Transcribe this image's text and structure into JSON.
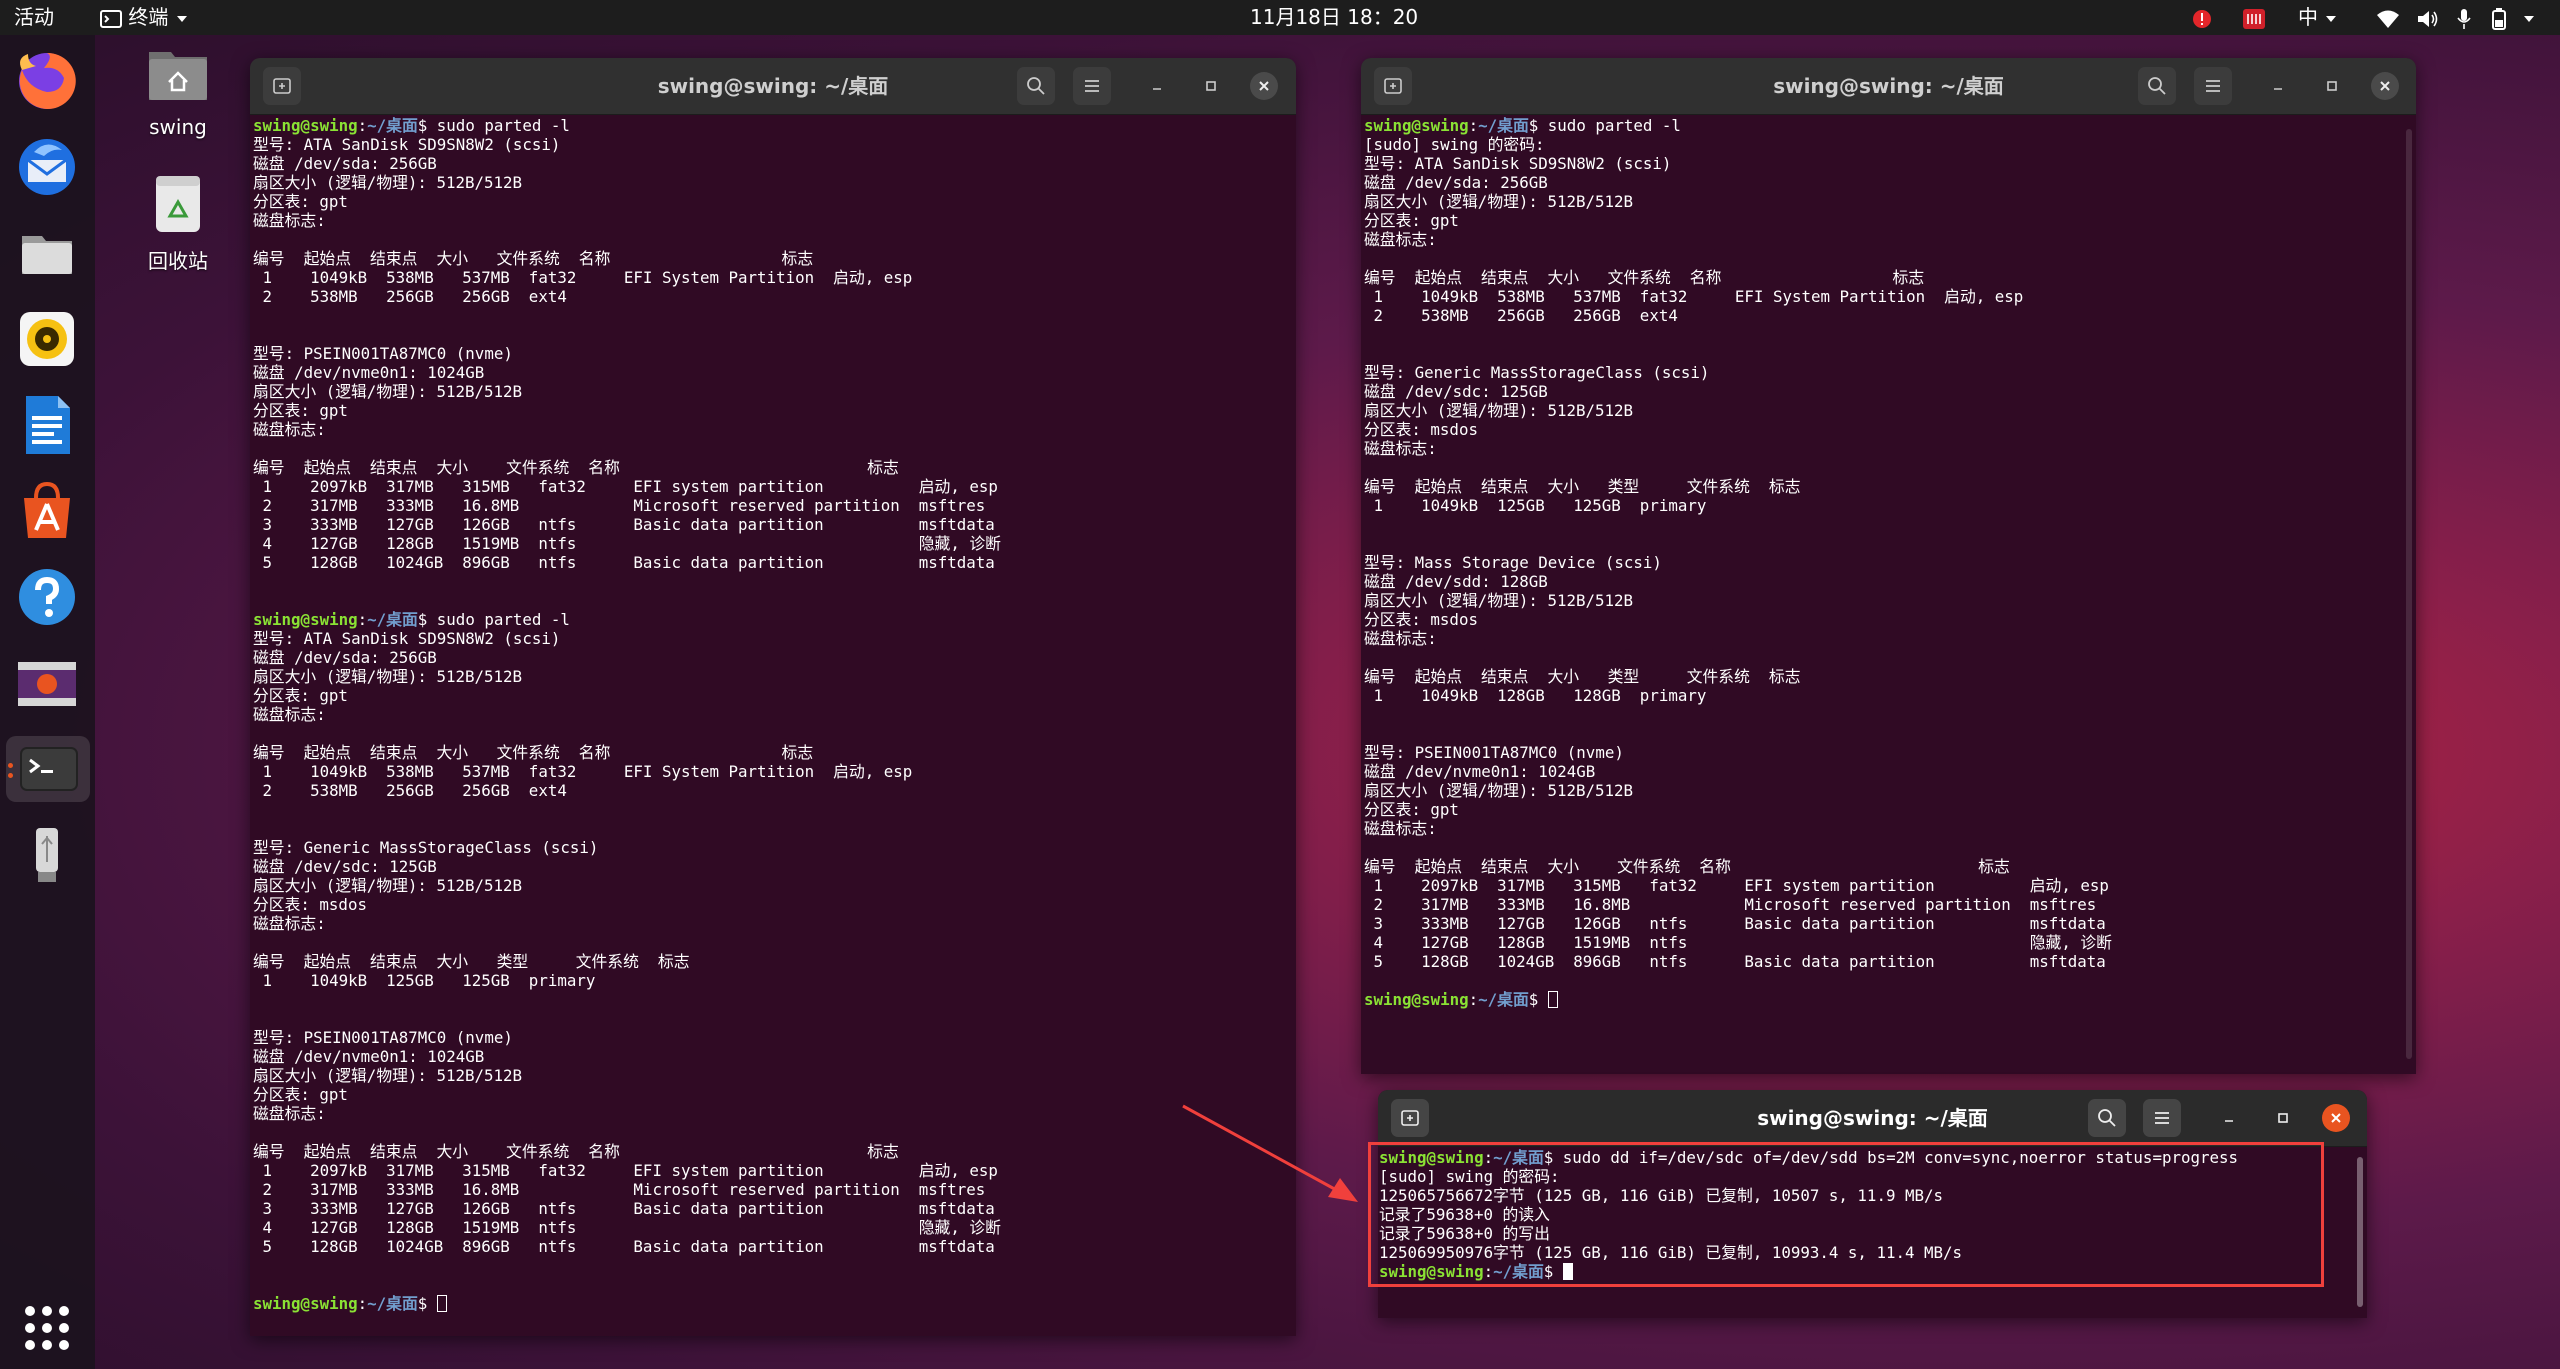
{
  "topbar": {
    "activities": "活动",
    "app_menu": "终端",
    "clock": "11月18日  18：20",
    "ime": "中",
    "accent_color": "#e95420"
  },
  "desktop": {
    "home_label": "swing",
    "trash_label": "回收站"
  },
  "dock": {
    "items": [
      "firefox-icon",
      "thunderbird-icon",
      "files-icon",
      "rhythmbox-icon",
      "writer-icon",
      "software-icon",
      "help-icon",
      "video-icon",
      "terminal-icon",
      "usb-drive-icon"
    ],
    "show_apps": "grid-icon"
  },
  "windows": {
    "left": {
      "title": "swing@swing: ~/桌面",
      "lines": [
        [
          {
            "t": "swing@swing",
            "c": "u"
          },
          {
            "t": ":"
          },
          {
            "t": "~/桌面",
            "c": "p"
          },
          {
            "t": "$ sudo parted -l"
          }
        ],
        [
          {
            "t": "型号: ATA SanDisk SD9SN8W2 (scsi)"
          }
        ],
        [
          {
            "t": "磁盘 /dev/sda: 256GB"
          }
        ],
        [
          {
            "t": "扇区大小 (逻辑/物理): 512B/512B"
          }
        ],
        [
          {
            "t": "分区表: gpt"
          }
        ],
        [
          {
            "t": "磁盘标志:"
          }
        ],
        [
          {
            "t": ""
          }
        ],
        [
          {
            "t": "编号  起始点  结束点  大小   文件系统  名称                  标志"
          }
        ],
        [
          {
            "t": " 1    1049kB  538MB   537MB  fat32     EFI System Partition  启动, esp"
          }
        ],
        [
          {
            "t": " 2    538MB   256GB   256GB  ext4"
          }
        ],
        [
          {
            "t": ""
          }
        ],
        [
          {
            "t": ""
          }
        ],
        [
          {
            "t": "型号: PSEIN001TA87MC0 (nvme)"
          }
        ],
        [
          {
            "t": "磁盘 /dev/nvme0n1: 1024GB"
          }
        ],
        [
          {
            "t": "扇区大小 (逻辑/物理): 512B/512B"
          }
        ],
        [
          {
            "t": "分区表: gpt"
          }
        ],
        [
          {
            "t": "磁盘标志:"
          }
        ],
        [
          {
            "t": ""
          }
        ],
        [
          {
            "t": "编号  起始点  结束点  大小    文件系统  名称                          标志"
          }
        ],
        [
          {
            "t": " 1    2097kB  317MB   315MB   fat32     EFI system partition          启动, esp"
          }
        ],
        [
          {
            "t": " 2    317MB   333MB   16.8MB            Microsoft reserved partition  msftres"
          }
        ],
        [
          {
            "t": " 3    333MB   127GB   126GB   ntfs      Basic data partition          msftdata"
          }
        ],
        [
          {
            "t": " 4    127GB   128GB   1519MB  ntfs                                    隐藏, 诊断"
          }
        ],
        [
          {
            "t": " 5    128GB   1024GB  896GB   ntfs      Basic data partition          msftdata"
          }
        ],
        [
          {
            "t": ""
          }
        ],
        [
          {
            "t": ""
          }
        ],
        [
          {
            "t": "swing@swing",
            "c": "u"
          },
          {
            "t": ":"
          },
          {
            "t": "~/桌面",
            "c": "p"
          },
          {
            "t": "$ sudo parted -l"
          }
        ],
        [
          {
            "t": "型号: ATA SanDisk SD9SN8W2 (scsi)"
          }
        ],
        [
          {
            "t": "磁盘 /dev/sda: 256GB"
          }
        ],
        [
          {
            "t": "扇区大小 (逻辑/物理): 512B/512B"
          }
        ],
        [
          {
            "t": "分区表: gpt"
          }
        ],
        [
          {
            "t": "磁盘标志:"
          }
        ],
        [
          {
            "t": ""
          }
        ],
        [
          {
            "t": "编号  起始点  结束点  大小   文件系统  名称                  标志"
          }
        ],
        [
          {
            "t": " 1    1049kB  538MB   537MB  fat32     EFI System Partition  启动, esp"
          }
        ],
        [
          {
            "t": " 2    538MB   256GB   256GB  ext4"
          }
        ],
        [
          {
            "t": ""
          }
        ],
        [
          {
            "t": ""
          }
        ],
        [
          {
            "t": "型号: Generic MassStorageClass (scsi)"
          }
        ],
        [
          {
            "t": "磁盘 /dev/sdc: 125GB"
          }
        ],
        [
          {
            "t": "扇区大小 (逻辑/物理): 512B/512B"
          }
        ],
        [
          {
            "t": "分区表: msdos"
          }
        ],
        [
          {
            "t": "磁盘标志:"
          }
        ],
        [
          {
            "t": ""
          }
        ],
        [
          {
            "t": "编号  起始点  结束点  大小   类型     文件系统  标志"
          }
        ],
        [
          {
            "t": " 1    1049kB  125GB   125GB  primary"
          }
        ],
        [
          {
            "t": ""
          }
        ],
        [
          {
            "t": ""
          }
        ],
        [
          {
            "t": "型号: PSEIN001TA87MC0 (nvme)"
          }
        ],
        [
          {
            "t": "磁盘 /dev/nvme0n1: 1024GB"
          }
        ],
        [
          {
            "t": "扇区大小 (逻辑/物理): 512B/512B"
          }
        ],
        [
          {
            "t": "分区表: gpt"
          }
        ],
        [
          {
            "t": "磁盘标志:"
          }
        ],
        [
          {
            "t": ""
          }
        ],
        [
          {
            "t": "编号  起始点  结束点  大小    文件系统  名称                          标志"
          }
        ],
        [
          {
            "t": " 1    2097kB  317MB   315MB   fat32     EFI system partition          启动, esp"
          }
        ],
        [
          {
            "t": " 2    317MB   333MB   16.8MB            Microsoft reserved partition  msftres"
          }
        ],
        [
          {
            "t": " 3    333MB   127GB   126GB   ntfs      Basic data partition          msftdata"
          }
        ],
        [
          {
            "t": " 4    127GB   128GB   1519MB  ntfs                                    隐藏, 诊断"
          }
        ],
        [
          {
            "t": " 5    128GB   1024GB  896GB   ntfs      Basic data partition          msftdata"
          }
        ],
        [
          {
            "t": ""
          }
        ],
        [
          {
            "t": ""
          }
        ],
        [
          {
            "t": "swing@swing",
            "c": "u"
          },
          {
            "t": ":"
          },
          {
            "t": "~/桌面",
            "c": "p"
          },
          {
            "t": "$ "
          },
          {
            "cursor": "hollow"
          }
        ]
      ]
    },
    "right": {
      "title": "swing@swing: ~/桌面",
      "lines": [
        [
          {
            "t": "swing@swing",
            "c": "u"
          },
          {
            "t": ":"
          },
          {
            "t": "~/桌面",
            "c": "p"
          },
          {
            "t": "$ sudo parted -l"
          }
        ],
        [
          {
            "t": "[sudo] swing 的密码:"
          }
        ],
        [
          {
            "t": "型号: ATA SanDisk SD9SN8W2 (scsi)"
          }
        ],
        [
          {
            "t": "磁盘 /dev/sda: 256GB"
          }
        ],
        [
          {
            "t": "扇区大小 (逻辑/物理): 512B/512B"
          }
        ],
        [
          {
            "t": "分区表: gpt"
          }
        ],
        [
          {
            "t": "磁盘标志:"
          }
        ],
        [
          {
            "t": ""
          }
        ],
        [
          {
            "t": "编号  起始点  结束点  大小   文件系统  名称                  标志"
          }
        ],
        [
          {
            "t": " 1    1049kB  538MB   537MB  fat32     EFI System Partition  启动, esp"
          }
        ],
        [
          {
            "t": " 2    538MB   256GB   256GB  ext4"
          }
        ],
        [
          {
            "t": ""
          }
        ],
        [
          {
            "t": ""
          }
        ],
        [
          {
            "t": "型号: Generic MassStorageClass (scsi)"
          }
        ],
        [
          {
            "t": "磁盘 /dev/sdc: 125GB"
          }
        ],
        [
          {
            "t": "扇区大小 (逻辑/物理): 512B/512B"
          }
        ],
        [
          {
            "t": "分区表: msdos"
          }
        ],
        [
          {
            "t": "磁盘标志:"
          }
        ],
        [
          {
            "t": ""
          }
        ],
        [
          {
            "t": "编号  起始点  结束点  大小   类型     文件系统  标志"
          }
        ],
        [
          {
            "t": " 1    1049kB  125GB   125GB  primary"
          }
        ],
        [
          {
            "t": ""
          }
        ],
        [
          {
            "t": ""
          }
        ],
        [
          {
            "t": "型号: Mass Storage Device (scsi)"
          }
        ],
        [
          {
            "t": "磁盘 /dev/sdd: 128GB"
          }
        ],
        [
          {
            "t": "扇区大小 (逻辑/物理): 512B/512B"
          }
        ],
        [
          {
            "t": "分区表: msdos"
          }
        ],
        [
          {
            "t": "磁盘标志:"
          }
        ],
        [
          {
            "t": ""
          }
        ],
        [
          {
            "t": "编号  起始点  结束点  大小   类型     文件系统  标志"
          }
        ],
        [
          {
            "t": " 1    1049kB  128GB   128GB  primary"
          }
        ],
        [
          {
            "t": ""
          }
        ],
        [
          {
            "t": ""
          }
        ],
        [
          {
            "t": "型号: PSEIN001TA87MC0 (nvme)"
          }
        ],
        [
          {
            "t": "磁盘 /dev/nvme0n1: 1024GB"
          }
        ],
        [
          {
            "t": "扇区大小 (逻辑/物理): 512B/512B"
          }
        ],
        [
          {
            "t": "分区表: gpt"
          }
        ],
        [
          {
            "t": "磁盘标志:"
          }
        ],
        [
          {
            "t": ""
          }
        ],
        [
          {
            "t": "编号  起始点  结束点  大小    文件系统  名称                          标志"
          }
        ],
        [
          {
            "t": " 1    2097kB  317MB   315MB   fat32     EFI system partition          启动, esp"
          }
        ],
        [
          {
            "t": " 2    317MB   333MB   16.8MB            Microsoft reserved partition  msftres"
          }
        ],
        [
          {
            "t": " 3    333MB   127GB   126GB   ntfs      Basic data partition          msftdata"
          }
        ],
        [
          {
            "t": " 4    127GB   128GB   1519MB  ntfs                                    隐藏, 诊断"
          }
        ],
        [
          {
            "t": " 5    128GB   1024GB  896GB   ntfs      Basic data partition          msftdata"
          }
        ],
        [
          {
            "t": ""
          }
        ],
        [
          {
            "t": "swing@swing",
            "c": "u"
          },
          {
            "t": ":"
          },
          {
            "t": "~/桌面",
            "c": "p"
          },
          {
            "t": "$ "
          },
          {
            "cursor": "hollow"
          }
        ]
      ]
    },
    "small": {
      "title": "swing@swing: ~/桌面",
      "lines": [
        [
          {
            "t": "swing@swing",
            "c": "u"
          },
          {
            "t": ":"
          },
          {
            "t": "~/桌面",
            "c": "p"
          },
          {
            "t": "$ sudo dd if=/dev/sdc of=/dev/sdd bs=2M conv=sync,noerror status=progress"
          }
        ],
        [
          {
            "t": "[sudo] swing 的密码:"
          }
        ],
        [
          {
            "t": "125065756672字节 (125 GB, 116 GiB) 已复制, 10507 s, 11.9 MB/s"
          }
        ],
        [
          {
            "t": "记录了59638+0 的读入"
          }
        ],
        [
          {
            "t": "记录了59638+0 的写出"
          }
        ],
        [
          {
            "t": "125069950976字节 (125 GB, 116 GiB) 已复制, 10993.4 s, 11.4 MB/s"
          }
        ],
        [
          {
            "t": "swing@swing",
            "c": "u"
          },
          {
            "t": ":"
          },
          {
            "t": "~/桌面",
            "c": "p"
          },
          {
            "t": "$ "
          },
          {
            "cursor": "solid"
          }
        ]
      ]
    }
  },
  "annotation": {
    "highlight_color": "#f0403c"
  }
}
